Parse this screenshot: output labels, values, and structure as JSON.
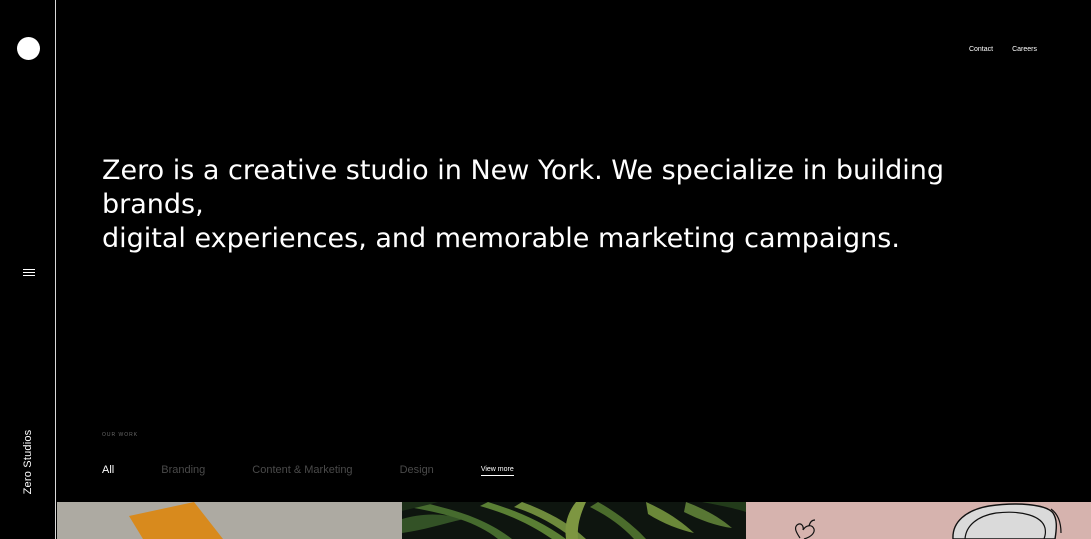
{
  "brand": {
    "vertical_name": "Zero Studios"
  },
  "nav": {
    "contact": "Contact",
    "careers": "Careers"
  },
  "hero": {
    "line1": "Zero is a creative studio in New York. We specialize in building brands,",
    "line2": "digital experiences, and memorable marketing campaigns."
  },
  "work": {
    "label": "OUR WORK",
    "filters": [
      "All",
      "Branding",
      "Content & Marketing",
      "Design"
    ],
    "active_filter": "All",
    "view_more": "View more"
  },
  "colors": {
    "background": "#000000",
    "text": "#ffffff",
    "inactive_filter": "#4a4a4a",
    "thumb_1": "#adaaa2",
    "thumb_1_accent": "#d88a1d",
    "thumb_2": "#0e150f",
    "thumb_3": "#d6b3ae"
  },
  "icons": {
    "logo": "filled-circle",
    "menu": "hamburger-icon"
  }
}
